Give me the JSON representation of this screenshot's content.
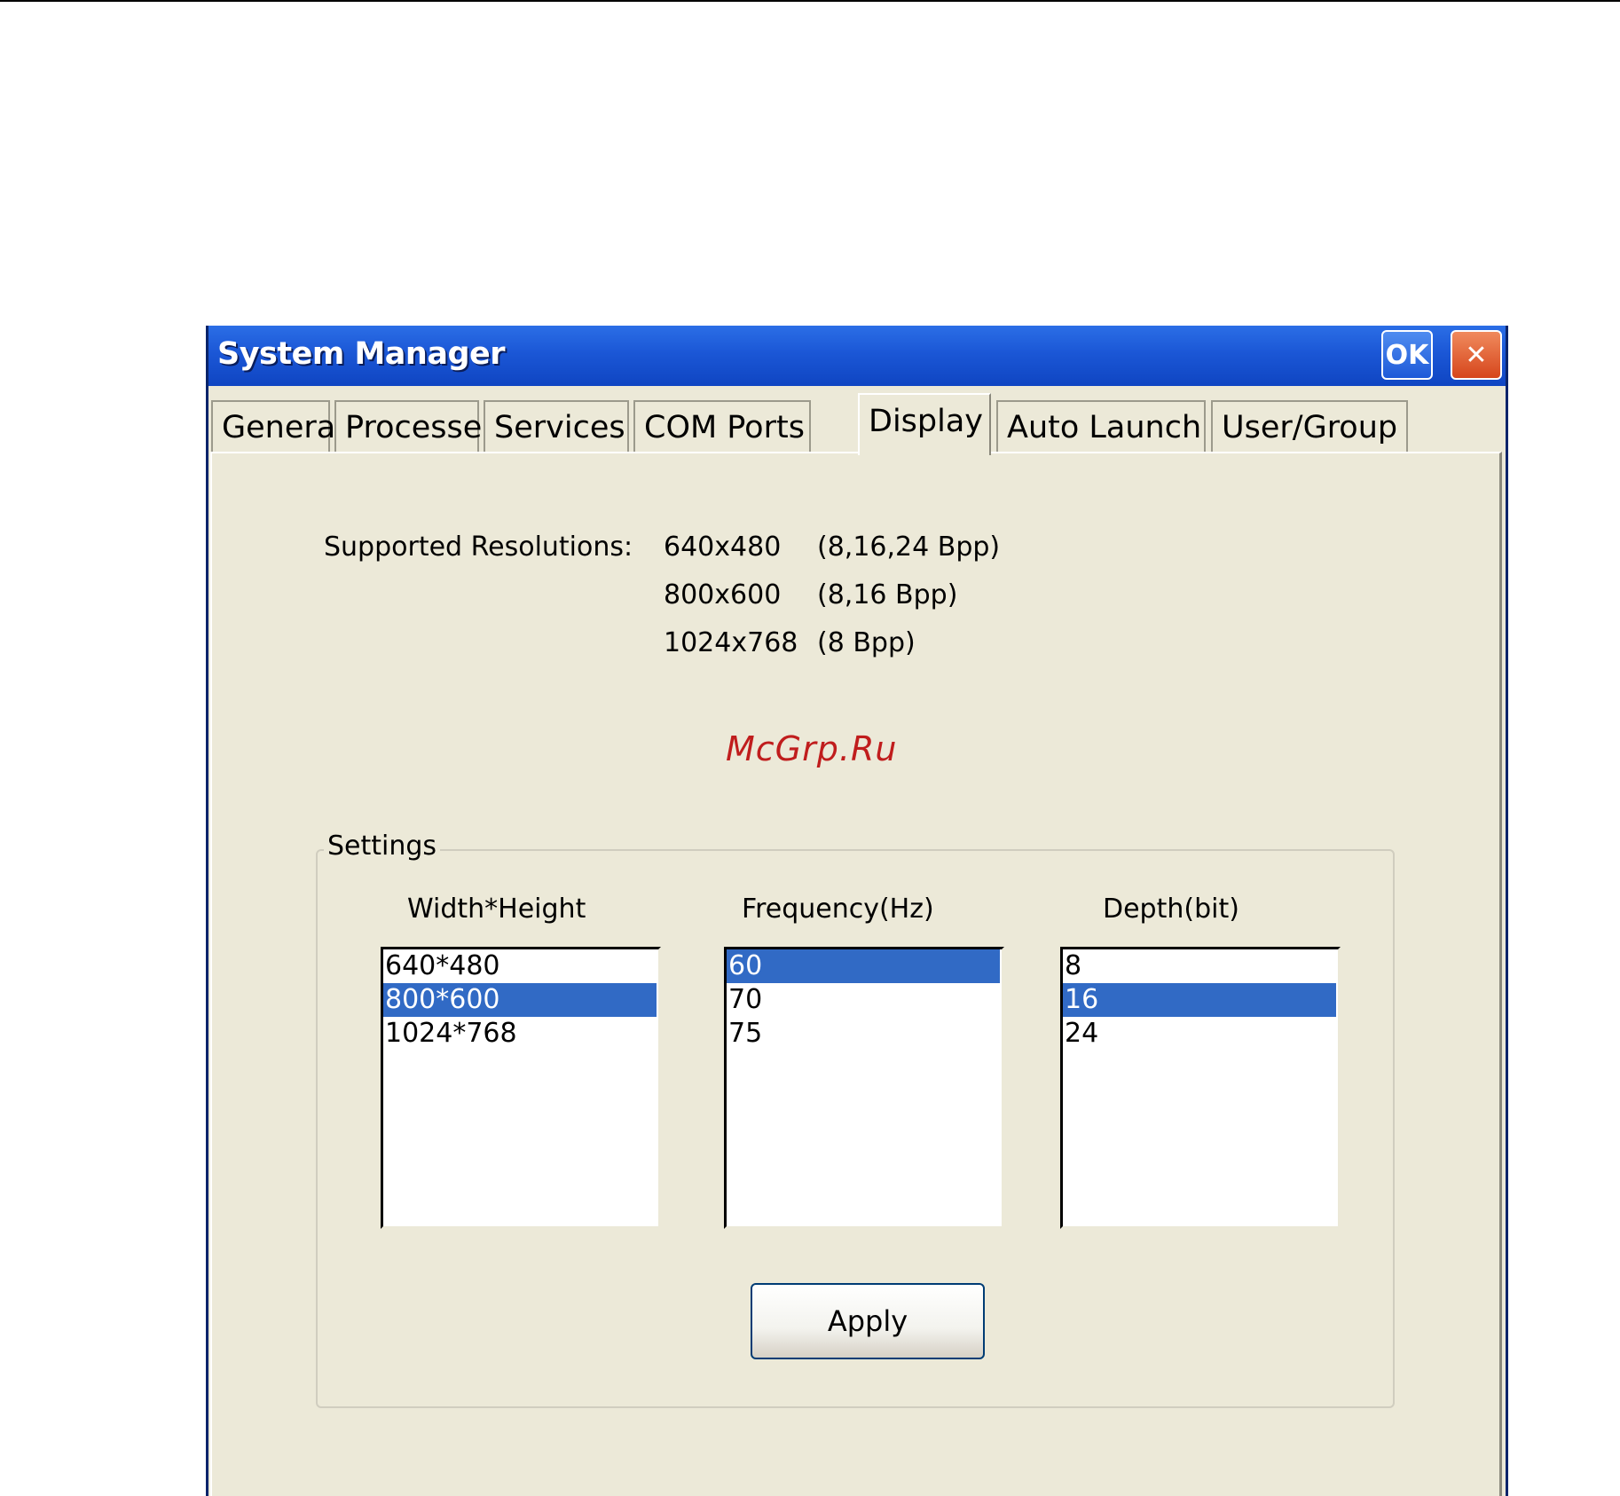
{
  "window": {
    "title": "System Manager",
    "ok_label": "OK",
    "close_glyph": "✕",
    "icons": {
      "close": "close-icon"
    }
  },
  "tabs": [
    {
      "label": "General"
    },
    {
      "label": "Processes"
    },
    {
      "label": "Services"
    },
    {
      "label": "COM Ports"
    },
    {
      "label": "Display",
      "active": true
    },
    {
      "label": "Auto Launch"
    },
    {
      "label": "User/Group"
    }
  ],
  "supported": {
    "label": "Supported Resolutions:",
    "rows": [
      {
        "resolution": "640x480",
        "bpp": "(8,16,24 Bpp)"
      },
      {
        "resolution": "800x600",
        "bpp": "(8,16 Bpp)"
      },
      {
        "resolution": "1024x768",
        "bpp": "(8 Bpp)"
      }
    ]
  },
  "settings": {
    "title": "Settings",
    "width_height": {
      "header": "Width*Height",
      "items": [
        "640*480",
        "800*600",
        "1024*768"
      ],
      "selected": "800*600"
    },
    "frequency": {
      "header": "Frequency(Hz)",
      "items": [
        "60",
        "70",
        "75"
      ],
      "selected": "60"
    },
    "depth": {
      "header": "Depth(bit)",
      "items": [
        "8",
        "16",
        "24"
      ],
      "selected": "16"
    },
    "apply_label": "Apply"
  },
  "watermark": "McGrp.Ru",
  "colors": {
    "titlebar": "#1b57d6",
    "selection": "#316ac5",
    "dialog_bg": "#ece9d8"
  }
}
